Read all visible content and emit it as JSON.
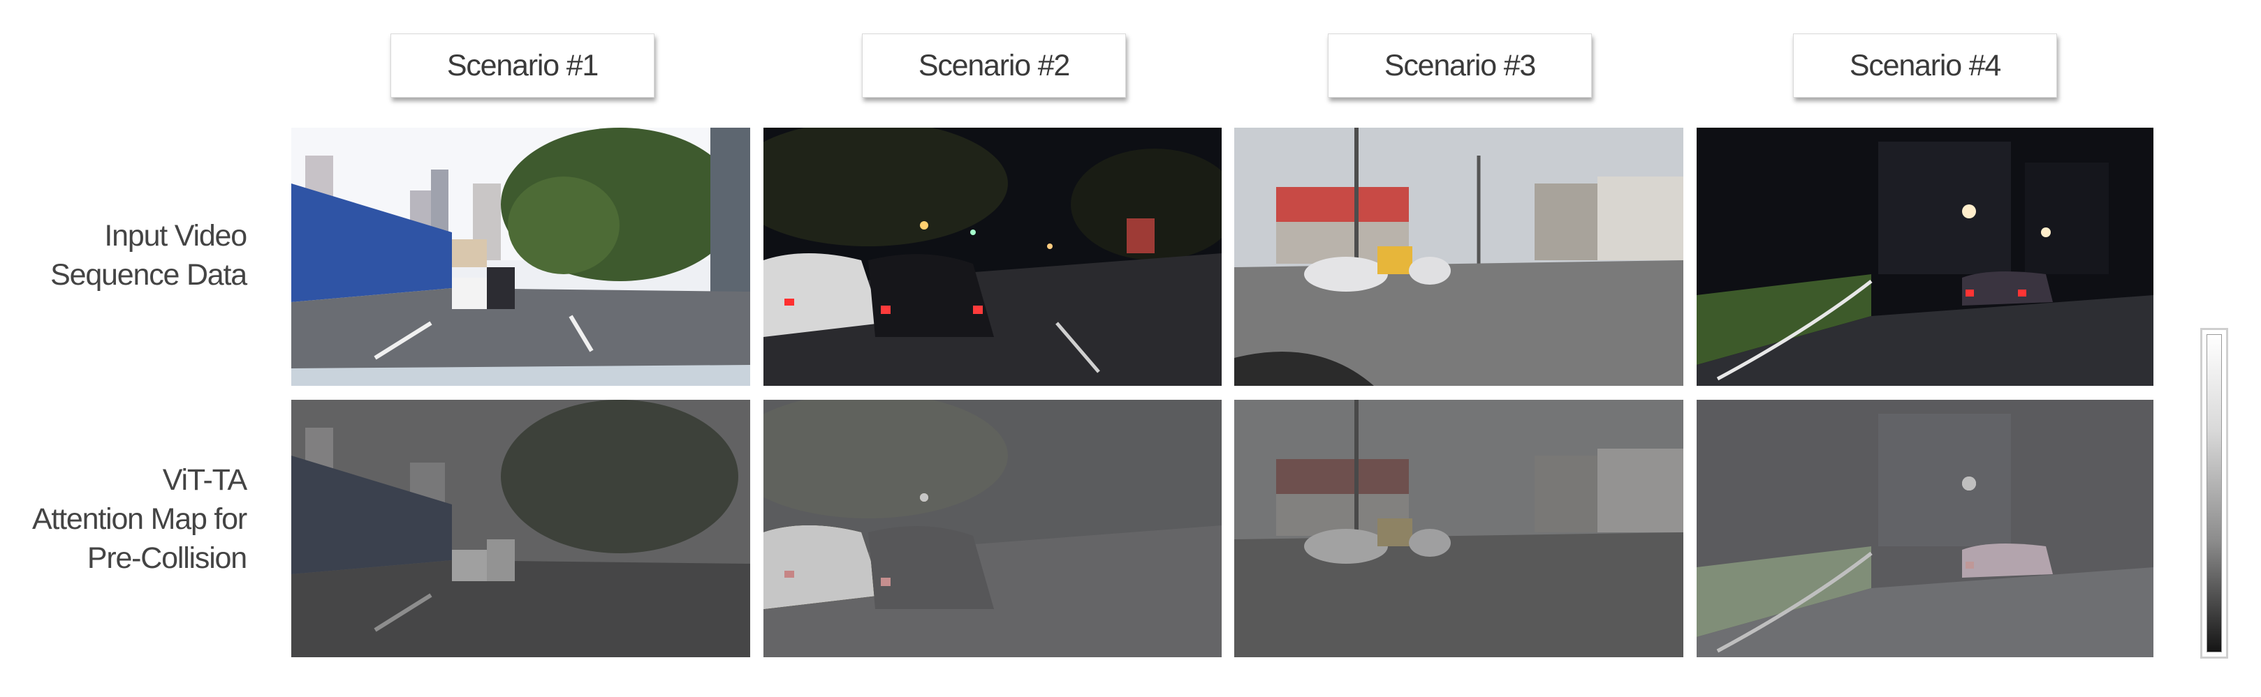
{
  "scenarios": [
    "Scenario #1",
    "Scenario #2",
    "Scenario #3",
    "Scenario #4"
  ],
  "rows": {
    "input": [
      "Input Video",
      "Sequence Data"
    ],
    "attention": [
      "ViT-TA",
      "Attention Map for",
      "Pre-Collision"
    ]
  },
  "colorbar": {
    "top_color": "#ffffff",
    "bottom_color": "#151515"
  }
}
